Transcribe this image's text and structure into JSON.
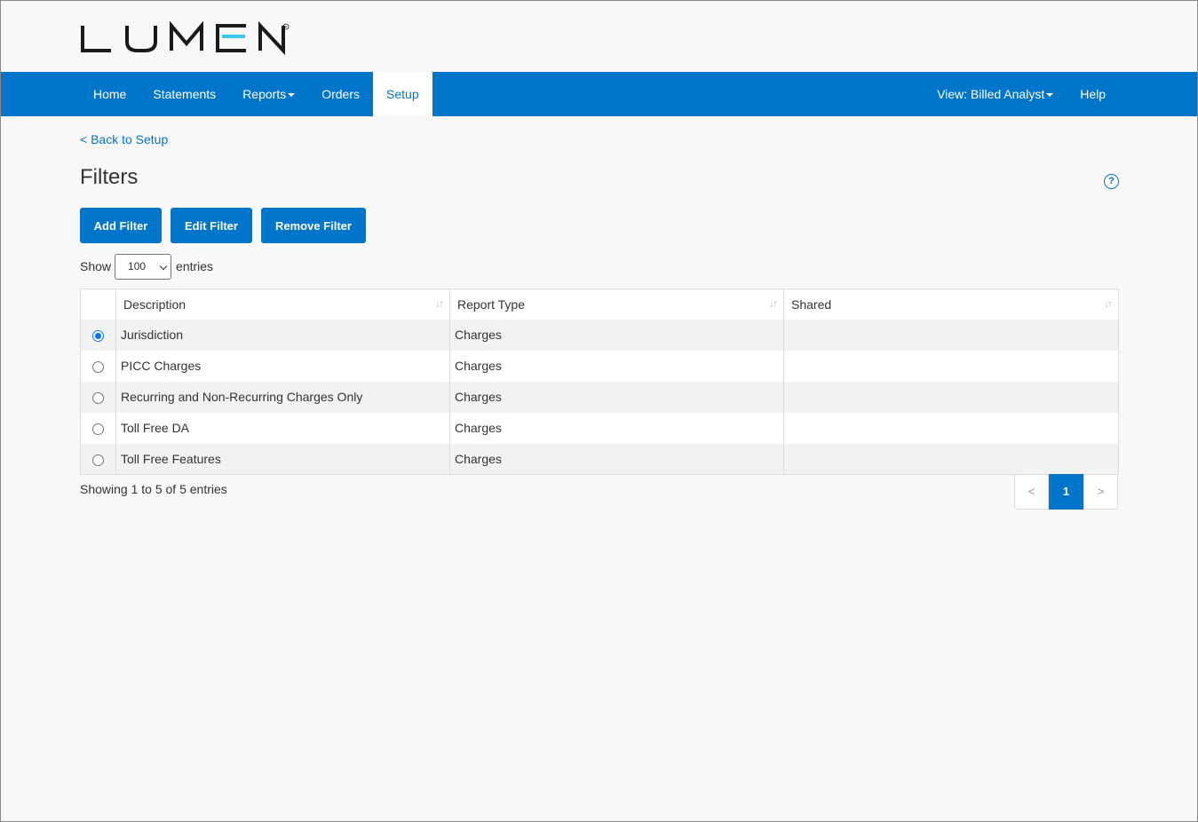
{
  "brand": {
    "logo_text": "LUMEN",
    "color": "#0075c9"
  },
  "nav": {
    "left": [
      {
        "label": "Home"
      },
      {
        "label": "Statements"
      },
      {
        "label": "Reports"
      },
      {
        "label": "Orders"
      },
      {
        "label": "Setup",
        "active": true
      }
    ],
    "right": [
      {
        "label": "View: Billed Analyst"
      },
      {
        "label": "Help"
      }
    ]
  },
  "back_link": "< Back to Setup",
  "page_title": "Filters",
  "help_icon": "?",
  "buttons": {
    "add": "Add Filter",
    "edit": "Edit Filter",
    "remove": "Remove Filter"
  },
  "length": {
    "show_label": "Show",
    "selected": "100",
    "entries_label": "entries"
  },
  "table": {
    "columns": [
      "Description",
      "Report Type",
      "Shared"
    ],
    "rows": [
      {
        "description": "Jurisdiction",
        "report_type": "Charges",
        "shared": "",
        "selected": true
      },
      {
        "description": "PICC Charges",
        "report_type": "Charges",
        "shared": "",
        "selected": false
      },
      {
        "description": "Recurring and Non-Recurring Charges Only",
        "report_type": "Charges",
        "shared": "",
        "selected": false
      },
      {
        "description": "Toll Free DA",
        "report_type": "Charges",
        "shared": "",
        "selected": false
      },
      {
        "description": "Toll Free Features",
        "report_type": "Charges",
        "shared": "",
        "selected": false
      }
    ]
  },
  "info": "Showing 1 to 5 of 5 entries",
  "pagination": {
    "prev": "<",
    "current": "1",
    "next": ">"
  }
}
